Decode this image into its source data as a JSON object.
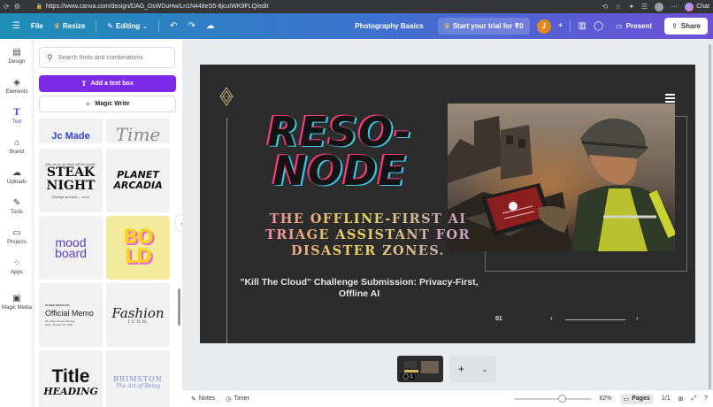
{
  "browser": {
    "url": "https://www.canva.com/design/DAG_DsWDuHw/Ln1N448eS5-8jcuIWK9FLQ/edit",
    "chat_label": "Chat"
  },
  "topbar": {
    "file": "File",
    "resize": "Resize",
    "editing": "Editing",
    "doc_title": "Photography Basics",
    "trial": "Start your trial for ₹0",
    "user_initial": "J",
    "present": "Present",
    "share": "Share"
  },
  "rail": {
    "items": [
      {
        "label": "Design",
        "icon": "layout-icon"
      },
      {
        "label": "Elements",
        "icon": "shapes-icon"
      },
      {
        "label": "Text",
        "icon": "text-t-icon"
      },
      {
        "label": "Brand",
        "icon": "brand-icon"
      },
      {
        "label": "Uploads",
        "icon": "cloud-upload-icon"
      },
      {
        "label": "Tools",
        "icon": "pen-tool-icon"
      },
      {
        "label": "Projects",
        "icon": "folder-icon"
      },
      {
        "label": "Apps",
        "icon": "apps-grid-icon"
      },
      {
        "label": "Magic Media",
        "icon": "image-magic-icon"
      }
    ]
  },
  "panel": {
    "search_placeholder": "Search fonts and combinations",
    "add_text_box": "Add a text box",
    "magic_write": "Magic Write",
    "tiles": {
      "partial_left": "Jc Made",
      "partial_right": "Time",
      "steak_kicker": "Join us as we start off the week!",
      "steak_title": "STEAK NIGHT",
      "steak_footer": "Fridays in town — soon",
      "planet": "PLANET ARCADIA",
      "mood": "mood board",
      "bold": "BOLD",
      "memo_kicker": "STUDIO MEDIA INC",
      "memo_title": "Official Memo",
      "memo_sub": "Re: Notes Board Meeting\nDate: January 30, 2025",
      "fashion": "Fashion",
      "fashion_sub": "ICON",
      "title_big": "Title",
      "title_heading": "HEADING",
      "brimston": "BRIMSTON",
      "brimston_sub": "The Art of Being"
    }
  },
  "slide": {
    "title_line1": "RESO-",
    "title_line2": "NODE",
    "subtitle": "THE OFFLINE-FIRST AI TRIAGE ASSISTANT FOR DISASTER ZONES.",
    "challenge": "\"Kill The Cloud\" Challenge Submission: Privacy-First, Offline AI",
    "page_number": "01",
    "prev": "‹",
    "next": "›"
  },
  "pagestrip": {
    "comment_count": "1",
    "add": "+"
  },
  "bottombar": {
    "notes": "Notes",
    "timer": "Timer",
    "zoom": "62%",
    "zoom_fraction": 0.62,
    "pages": "Pages",
    "page_count": "1/1"
  },
  "colors": {
    "accent": "#7d2ae8",
    "topbar_start": "#1e8fb7",
    "topbar_end": "#6d4fd6",
    "slide_bg": "#2c2c2c",
    "title_pink": "#ff3b7f",
    "title_cyan": "#3ec7e6"
  }
}
